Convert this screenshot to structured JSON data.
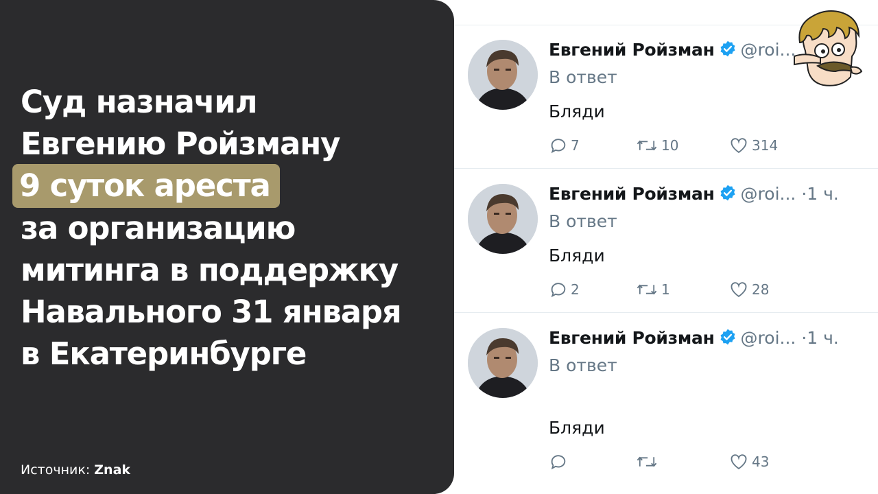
{
  "headline": {
    "line1": "Суд назначил",
    "line2": "Евгению Ройзману",
    "highlight": "9 суток ареста",
    "line4": "за организацию",
    "line5": "митинга в поддержку",
    "line6": "Навального 31 января",
    "line7": "в Екатеринбурге",
    "highlight_color": "#a89a6c"
  },
  "source": {
    "label": "Источник:",
    "name": "Znak"
  },
  "tweets": [
    {
      "name": "Евгений Ройзман",
      "handle": "@roi...",
      "time": "",
      "reply": "В ответ",
      "text": "Бляди",
      "replies": "7",
      "retweets": "10",
      "likes": "314"
    },
    {
      "name": "Евгений Ройзман",
      "handle": "@roi...",
      "time": "·1 ч.",
      "reply": "В ответ",
      "text": "Бляди",
      "replies": "2",
      "retweets": "1",
      "likes": "28"
    },
    {
      "name": "Евгений Ройзман",
      "handle": "@roi...",
      "time": "·1 ч.",
      "reply": "В ответ",
      "text": "Бляди",
      "replies": "",
      "retweets": "",
      "likes": "43"
    }
  ],
  "colors": {
    "panel": "#2b2b2d",
    "verified": "#1da1f2",
    "muted": "#657786"
  },
  "icons": [
    "verified-badge-icon",
    "reply-icon",
    "retweet-icon",
    "like-icon",
    "mascot-logo"
  ]
}
